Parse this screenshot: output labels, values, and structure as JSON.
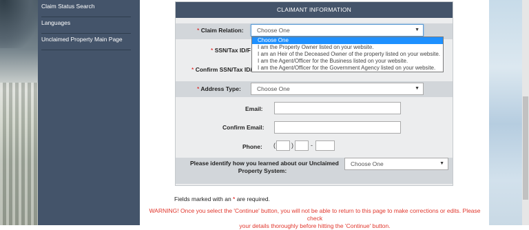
{
  "sidebar": {
    "items": [
      {
        "label": "Claim Status Search"
      },
      {
        "label": "Languages"
      },
      {
        "label": "Unclaimed Property Main Page"
      }
    ]
  },
  "form": {
    "header": "CLAIMANT INFORMATION",
    "required_mark": "*",
    "claim_relation": {
      "label": "Claim Relation:",
      "value": "Choose One",
      "options": [
        "Choose One",
        "I am the Property Owner listed on your website.",
        "I am an Heir of the Deceased Owner of the property listed on your website.",
        "I am the Agent/Officer for the Business listed on your website.",
        "I am the Agent/Officer for the Government Agency listed on your website."
      ]
    },
    "ssn": {
      "label": "SSN/Tax ID/F"
    },
    "confirm_ssn": {
      "label": "Confirm SSN/Tax ID/F"
    },
    "address_type": {
      "label": "Address Type:",
      "value": "Choose One"
    },
    "email": {
      "label": "Email:"
    },
    "confirm_email": {
      "label": "Confirm Email:"
    },
    "phone": {
      "label": "Phone:",
      "open_paren": "(",
      "close_paren": ")",
      "dash": "-"
    },
    "learned": {
      "label_line1": "Please identify how you learned about our Unclaimed",
      "label_line2": "Property System:",
      "value": "Choose One"
    }
  },
  "footer": {
    "note_prefix": "Fields marked with an ",
    "note_mark": "*",
    "note_suffix": " are required.",
    "warning_line1": "WARNING! Once you select the 'Continue' button, you will not be able to return to this page to make corrections or edits. Please check",
    "warning_line2": "your details thoroughly before hitting the 'Continue' button."
  },
  "icons": {
    "select_chevron": "chevron-down-icon"
  },
  "colors": {
    "sidebar_bg": "#44546a",
    "required": "#dd0000",
    "warning": "#e0352b",
    "dropdown_highlight": "#1e90ff"
  }
}
